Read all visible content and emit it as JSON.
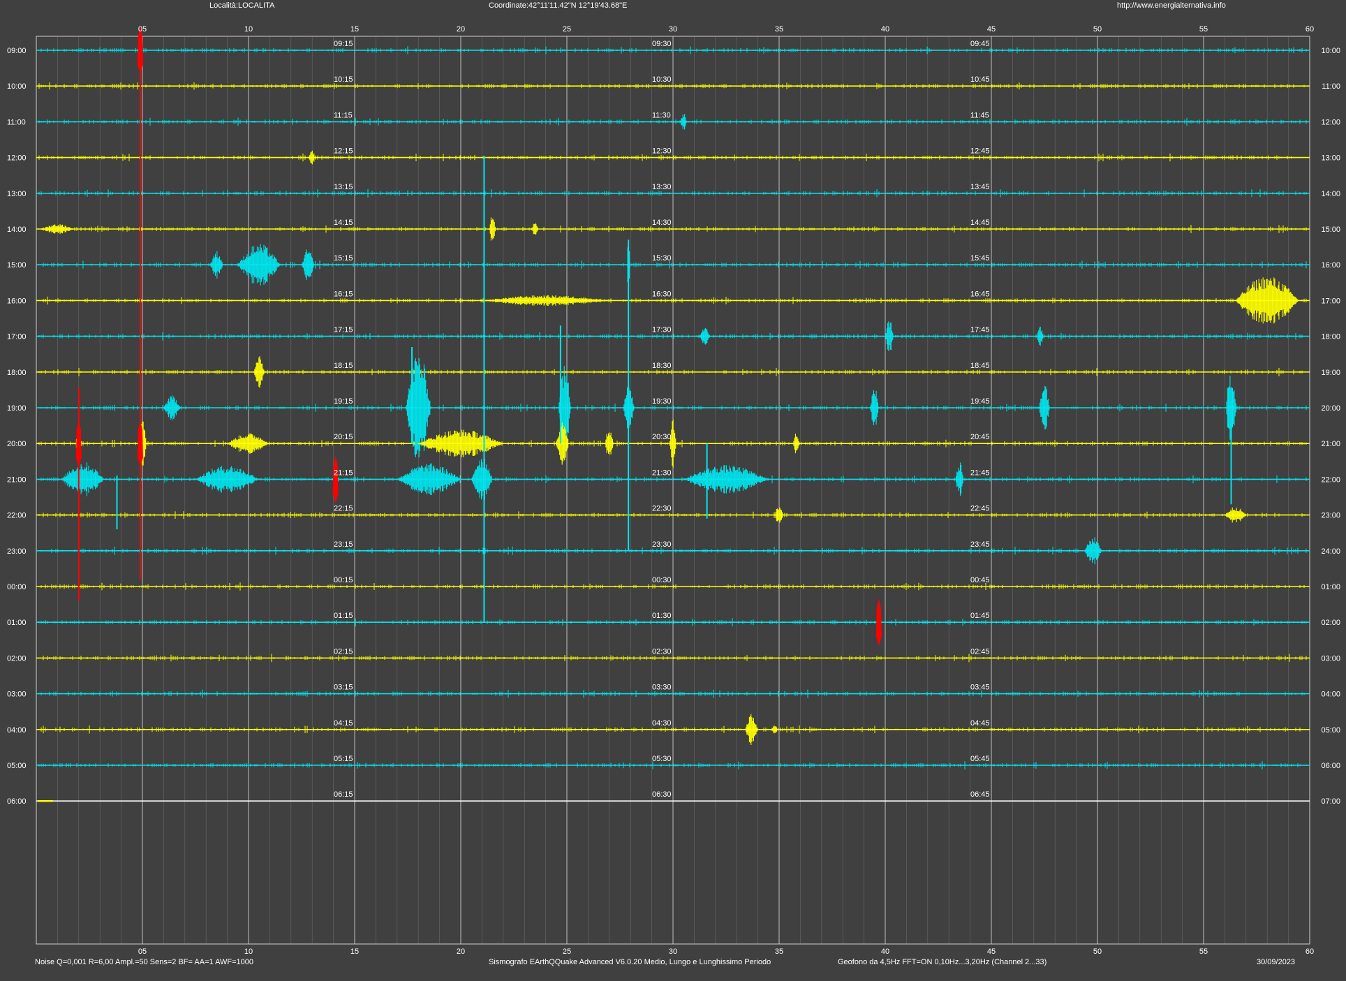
{
  "header": {
    "location": "Località:LOCALITA",
    "coordinates": "Coordinate:42°11'11.42\"N  12°19'43.68\"E",
    "url": "http://www.energialternativa.info"
  },
  "footer": {
    "params": "Noise Q=0,001 R=6,00 Ampl.=50 Sens=2 BF= AA=1 AWF=1000",
    "software": "Sismografo  EArthQQuake Advanced V6.0.20  Medio, Lungo e Lunghissimo Periodo",
    "sensor": "Geofono da 4,5Hz FFT=ON 0,10Hz...3,20Hz      (Channel 2...33)",
    "date": "30/09/2023"
  },
  "colors": {
    "background": "#404040",
    "plot_background": "#404040",
    "gridline": "#9a9a9a",
    "gridline_major": "#d8d8d8",
    "trace_cyan": "#00e5ee",
    "trace_yellow": "#ffff00",
    "event_red": "#ff0000",
    "text": "#ffffff"
  },
  "chart_data": {
    "type": "line",
    "title": "",
    "xlabel": "",
    "ylabel": "",
    "xlim": [
      0,
      60
    ],
    "x_unit": "minutes",
    "x_tick_labels": [
      "05",
      "10",
      "15",
      "20",
      "25",
      "30",
      "35",
      "40",
      "45",
      "50",
      "55",
      "60"
    ],
    "x_tick_values": [
      5,
      10,
      15,
      20,
      25,
      30,
      35,
      40,
      45,
      50,
      55,
      60
    ],
    "minor_grid_step_minutes": 1,
    "grid": true,
    "rows": [
      {
        "left": "09:00",
        "right": "10:00",
        "q15": "09:15",
        "q30": "09:30",
        "q45": "09:45",
        "color": "cyan"
      },
      {
        "left": "10:00",
        "right": "11:00",
        "q15": "10:15",
        "q30": "10:30",
        "q45": "10:45",
        "color": "yellow"
      },
      {
        "left": "11:00",
        "right": "12:00",
        "q15": "11:15",
        "q30": "11:30",
        "q45": "11:45",
        "color": "cyan"
      },
      {
        "left": "12:00",
        "right": "13:00",
        "q15": "12:15",
        "q30": "12:30",
        "q45": "12:45",
        "color": "yellow"
      },
      {
        "left": "13:00",
        "right": "14:00",
        "q15": "13:15",
        "q30": "13:30",
        "q45": "13:45",
        "color": "cyan"
      },
      {
        "left": "14:00",
        "right": "15:00",
        "q15": "14:15",
        "q30": "14:30",
        "q45": "14:45",
        "color": "yellow"
      },
      {
        "left": "15:00",
        "right": "16:00",
        "q15": "15:15",
        "q30": "15:30",
        "q45": "15:45",
        "color": "cyan"
      },
      {
        "left": "16:00",
        "right": "17:00",
        "q15": "16:15",
        "q30": "16:30",
        "q45": "16:45",
        "color": "yellow"
      },
      {
        "left": "17:00",
        "right": "18:00",
        "q15": "17:15",
        "q30": "17:30",
        "q45": "17:45",
        "color": "cyan"
      },
      {
        "left": "18:00",
        "right": "19:00",
        "q15": "18:15",
        "q30": "18:30",
        "q45": "18:45",
        "color": "yellow"
      },
      {
        "left": "19:00",
        "right": "20:00",
        "q15": "19:15",
        "q30": "19:30",
        "q45": "19:45",
        "color": "cyan"
      },
      {
        "left": "20:00",
        "right": "21:00",
        "q15": "20:15",
        "q30": "20:30",
        "q45": "20:45",
        "color": "yellow"
      },
      {
        "left": "21:00",
        "right": "22:00",
        "q15": "21:15",
        "q30": "21:30",
        "q45": "21:45",
        "color": "cyan"
      },
      {
        "left": "22:00",
        "right": "23:00",
        "q15": "22:15",
        "q30": "22:30",
        "q45": "22:45",
        "color": "yellow"
      },
      {
        "left": "23:00",
        "right": "24:00",
        "q15": "23:15",
        "q30": "23:30",
        "q45": "23:45",
        "color": "cyan"
      },
      {
        "left": "00:00",
        "right": "01:00",
        "q15": "00:15",
        "q30": "00:30",
        "q45": "00:45",
        "color": "yellow"
      },
      {
        "left": "01:00",
        "right": "02:00",
        "q15": "01:15",
        "q30": "01:30",
        "q45": "01:45",
        "color": "cyan"
      },
      {
        "left": "02:00",
        "right": "03:00",
        "q15": "02:15",
        "q30": "02:30",
        "q45": "02:45",
        "color": "yellow"
      },
      {
        "left": "03:00",
        "right": "04:00",
        "q15": "03:15",
        "q30": "03:30",
        "q45": "03:45",
        "color": "cyan"
      },
      {
        "left": "04:00",
        "right": "05:00",
        "q15": "04:15",
        "q30": "04:30",
        "q45": "04:45",
        "color": "yellow"
      },
      {
        "left": "05:00",
        "right": "06:00",
        "q15": "05:15",
        "q30": "05:30",
        "q45": "05:45",
        "color": "cyan"
      },
      {
        "left": "06:00",
        "right": "07:00",
        "q15": "06:15",
        "q30": "06:30",
        "q45": "06:45",
        "color": "white"
      }
    ],
    "events": [
      {
        "row": 2,
        "minute": 30.5,
        "amplitude": 0.25,
        "duration": 0.3,
        "color": "cyan"
      },
      {
        "row": 3,
        "minute": 13,
        "amplitude": 0.2,
        "duration": 0.3,
        "color": "yellow"
      },
      {
        "row": 5,
        "minute": 21.5,
        "amplitude": 0.45,
        "duration": 0.3,
        "color": "yellow"
      },
      {
        "row": 5,
        "minute": 23.5,
        "amplitude": 0.25,
        "duration": 0.3,
        "color": "yellow"
      },
      {
        "row": 5,
        "minute": 1,
        "amplitude": 0.15,
        "duration": 1.5,
        "color": "yellow"
      },
      {
        "row": 6,
        "minute": 8.5,
        "amplitude": 0.4,
        "duration": 0.6,
        "color": "cyan"
      },
      {
        "row": 6,
        "minute": 10.5,
        "amplitude": 0.6,
        "duration": 2.0,
        "color": "cyan"
      },
      {
        "row": 6,
        "minute": 12.8,
        "amplitude": 0.45,
        "duration": 0.6,
        "color": "cyan"
      },
      {
        "row": 6,
        "minute": 27.9,
        "amplitude": 0.7,
        "duration": 0.15,
        "color": "cyan"
      },
      {
        "row": 7,
        "minute": 24,
        "amplitude": 0.15,
        "duration": 6.0,
        "color": "yellow"
      },
      {
        "row": 7,
        "minute": 58,
        "amplitude": 0.7,
        "duration": 3.0,
        "color": "yellow"
      },
      {
        "row": 8,
        "minute": 31.5,
        "amplitude": 0.25,
        "duration": 0.5,
        "color": "cyan"
      },
      {
        "row": 8,
        "minute": 40.2,
        "amplitude": 0.5,
        "duration": 0.4,
        "color": "cyan"
      },
      {
        "row": 8,
        "minute": 47.3,
        "amplitude": 0.3,
        "duration": 0.3,
        "color": "cyan"
      },
      {
        "row": 9,
        "minute": 10.5,
        "amplitude": 0.45,
        "duration": 0.5,
        "color": "yellow"
      },
      {
        "row": 10,
        "minute": 6.4,
        "amplitude": 0.35,
        "duration": 0.8,
        "color": "cyan"
      },
      {
        "row": 10,
        "minute": 18,
        "amplitude": 1.6,
        "duration": 1.2,
        "color": "cyan"
      },
      {
        "row": 10,
        "minute": 24.9,
        "amplitude": 1.2,
        "duration": 0.6,
        "color": "cyan"
      },
      {
        "row": 10,
        "minute": 27.9,
        "amplitude": 0.8,
        "duration": 0.5,
        "color": "cyan"
      },
      {
        "row": 10,
        "minute": 39.5,
        "amplitude": 0.6,
        "duration": 0.4,
        "color": "cyan"
      },
      {
        "row": 10,
        "minute": 47.5,
        "amplitude": 0.8,
        "duration": 0.5,
        "color": "cyan"
      },
      {
        "row": 10,
        "minute": 56.3,
        "amplitude": 1.2,
        "duration": 0.5,
        "color": "cyan"
      },
      {
        "row": 11,
        "minute": 2,
        "amplitude": 0.6,
        "duration": 0.3,
        "color": "yellow"
      },
      {
        "row": 11,
        "minute": 5,
        "amplitude": 0.9,
        "duration": 0.4,
        "color": "yellow"
      },
      {
        "row": 11,
        "minute": 10,
        "amplitude": 0.3,
        "duration": 2.0,
        "color": "yellow"
      },
      {
        "row": 11,
        "minute": 20,
        "amplitude": 0.4,
        "duration": 4.0,
        "color": "yellow"
      },
      {
        "row": 11,
        "minute": 24.8,
        "amplitude": 0.6,
        "duration": 0.6,
        "color": "yellow"
      },
      {
        "row": 11,
        "minute": 27,
        "amplitude": 0.5,
        "duration": 0.4,
        "color": "yellow"
      },
      {
        "row": 11,
        "minute": 30,
        "amplitude": 0.8,
        "duration": 0.3,
        "color": "yellow"
      },
      {
        "row": 11,
        "minute": 35.8,
        "amplitude": 0.3,
        "duration": 0.3,
        "color": "yellow"
      },
      {
        "row": 12,
        "minute": 2.2,
        "amplitude": 0.5,
        "duration": 2.0,
        "color": "cyan"
      },
      {
        "row": 12,
        "minute": 9,
        "amplitude": 0.4,
        "duration": 3.0,
        "color": "cyan"
      },
      {
        "row": 12,
        "minute": 18.5,
        "amplitude": 0.45,
        "duration": 3.0,
        "color": "cyan"
      },
      {
        "row": 12,
        "minute": 21,
        "amplitude": 0.7,
        "duration": 1.0,
        "color": "cyan"
      },
      {
        "row": 12,
        "minute": 32.5,
        "amplitude": 0.4,
        "duration": 4.0,
        "color": "cyan"
      },
      {
        "row": 12,
        "minute": 43.5,
        "amplitude": 0.5,
        "duration": 0.4,
        "color": "cyan"
      },
      {
        "row": 13,
        "minute": 35,
        "amplitude": 0.3,
        "duration": 0.4,
        "color": "yellow"
      },
      {
        "row": 13,
        "minute": 56.5,
        "amplitude": 0.25,
        "duration": 1.0,
        "color": "yellow"
      },
      {
        "row": 14,
        "minute": 49.8,
        "amplitude": 0.4,
        "duration": 0.8,
        "color": "cyan"
      },
      {
        "row": 19,
        "minute": 33.7,
        "amplitude": 0.45,
        "duration": 0.6,
        "color": "yellow"
      },
      {
        "row": 19,
        "minute": 34.8,
        "amplitude": 0.15,
        "duration": 0.3,
        "color": "yellow"
      }
    ],
    "spikes": [
      {
        "row": 4,
        "minute": 21.1,
        "up": 1.05,
        "down": 12.0,
        "color": "cyan"
      },
      {
        "row": 8,
        "minute": 27.9,
        "up": 2.7,
        "down": 6.0,
        "color": "cyan"
      },
      {
        "row": 10,
        "minute": 17.7,
        "up": 1.7,
        "down": 1.0,
        "color": "cyan"
      },
      {
        "row": 10,
        "minute": 24.7,
        "up": 2.3,
        "down": 1.0,
        "color": "cyan"
      },
      {
        "row": 12,
        "minute": 3.8,
        "up": 0.1,
        "down": 1.4,
        "color": "cyan"
      },
      {
        "row": 12,
        "minute": 31.6,
        "up": 1.0,
        "down": 1.1,
        "color": "cyan"
      },
      {
        "row": 12,
        "minute": 56.3,
        "up": 2.2,
        "down": 0.7,
        "color": "cyan"
      }
    ],
    "red_markers": [
      {
        "row": 11,
        "minute": 4.9,
        "from_row": 7.8,
        "to_row": 14.8
      },
      {
        "row": 11,
        "minute": 2.0,
        "from_row": 9.45,
        "to_row": 15.4
      },
      {
        "row": 12,
        "minute": 14.1,
        "from_row": 11.8,
        "to_row": 12.3
      },
      {
        "row": 16,
        "minute": 39.7,
        "from_row": 15.8,
        "to_row": 16.3
      },
      {
        "row": 0,
        "minute": 4.9,
        "from_row": -0.4,
        "to_row": 7.8
      }
    ]
  }
}
